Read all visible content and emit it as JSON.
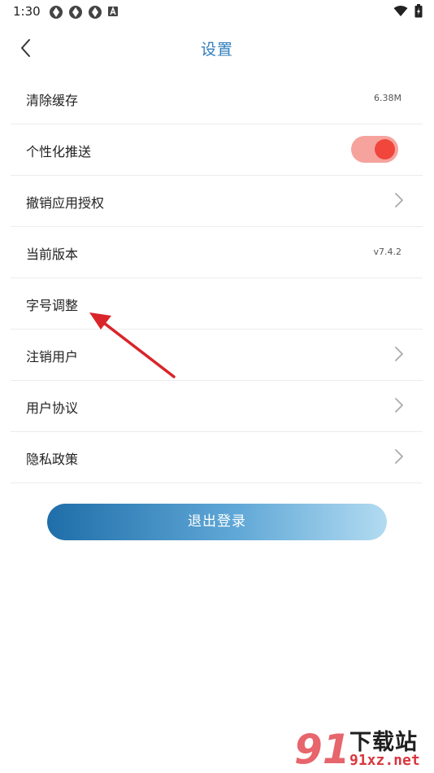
{
  "status_bar": {
    "time": "1:30"
  },
  "nav": {
    "title": "设置"
  },
  "settings": {
    "clear_cache": {
      "label": "清除缓存",
      "value": "6.38M"
    },
    "personalized_push": {
      "label": "个性化推送",
      "enabled": true
    },
    "revoke_auth": {
      "label": "撤销应用授权"
    },
    "current_version": {
      "label": "当前版本",
      "value": "v7.4.2"
    },
    "font_size": {
      "label": "字号调整"
    },
    "cancel_account": {
      "label": "注销用户"
    },
    "user_agreement": {
      "label": "用户协议"
    },
    "privacy_policy": {
      "label": "隐私政策"
    }
  },
  "logout": {
    "label": "退出登录"
  },
  "watermark": {
    "title": "下载站",
    "site": "91xz.net",
    "logo_text": "91"
  },
  "colors": {
    "accent": "#2f7dbd",
    "toggle_track": "#f6a39d",
    "toggle_knob": "#f0463c",
    "annotation": "#d9252a"
  }
}
